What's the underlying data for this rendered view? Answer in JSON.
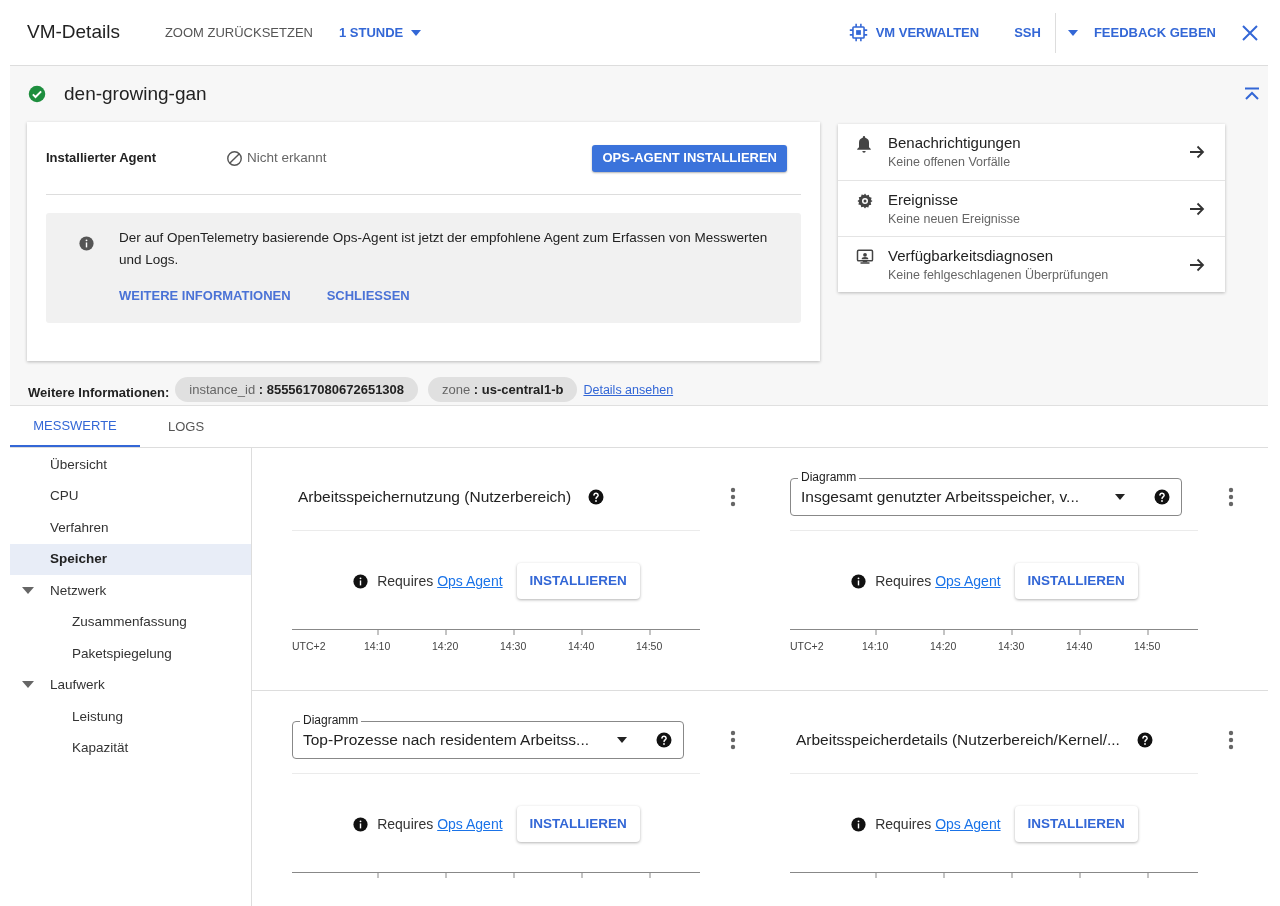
{
  "header": {
    "title": "VM-Details",
    "zoom_reset": "ZOOM ZURÜCKSETZEN",
    "time_range": "1 STUNDE",
    "manage": "VM VERWALTEN",
    "ssh": "SSH",
    "feedback": "FEEDBACK GEBEN"
  },
  "instance": {
    "name": "den-growing-gan",
    "running": true
  },
  "agent": {
    "label": "Installierter Agent",
    "status": "Nicht erkannt",
    "install_button": "OPS-AGENT INSTALLIEREN",
    "notice": "Der auf OpenTelemetry basierende Ops-Agent ist jetzt der empfohlene Agent zum Erfassen von Messwerten und Logs.",
    "actions": [
      "WEITERE INFORMATIONEN",
      "SCHLIESSEN"
    ]
  },
  "links": [
    {
      "kind": "bell",
      "title": "Benachrichtigungen",
      "subtitle": "Keine offenen Vorfälle"
    },
    {
      "kind": "gear",
      "title": "Ereignisse",
      "subtitle": "Keine neuen Ereignisse"
    },
    {
      "kind": "monitor",
      "title": "Verfügbarkeitsdiagnosen",
      "subtitle": "Keine fehlgeschlagenen Überprüfungen"
    }
  ],
  "more_info": {
    "label": "Weitere Informationen:",
    "chips": [
      "instance_id **: 8555617080672651308**",
      "zone **: us-central1-b**"
    ],
    "link": "Details ansehen"
  },
  "tabs": [
    {
      "label": "MESSWERTE",
      "selected": true
    },
    {
      "label": "LOGS",
      "selected": false
    }
  ],
  "sidebar": [
    {
      "label": "Übersicht",
      "selected": false
    },
    {
      "label": "CPU",
      "selected": false
    },
    {
      "label": "Verfahren",
      "selected": false
    },
    {
      "label": "Speicher",
      "selected": true
    },
    {
      "label": "Netzwerk",
      "selected": false,
      "expanded": true,
      "children": [
        {
          "label": "Zusammenfassung",
          "selected": false
        },
        {
          "label": "Paketspiegelung",
          "selected": false
        }
      ]
    },
    {
      "label": "Laufwerk",
      "selected": false,
      "expanded": true,
      "children": [
        {
          "label": "Leistung",
          "selected": false
        },
        {
          "label": "Kapazität",
          "selected": false
        }
      ]
    }
  ],
  "charts": [
    {
      "kind": "title",
      "title": "Arbeitsspeichernutzung (Nutzerbereich)",
      "requires": "Requires",
      "link": "Ops Agent",
      "button": "INSTALLIEREN",
      "axis_labels": [
        "UTC+2",
        "14:10",
        "14:20",
        "14:30",
        "14:40",
        "14:50"
      ]
    },
    {
      "kind": "select",
      "select_label": "Diagramm",
      "title": "Insgesamt genutzter Arbeitsspeicher, v...",
      "requires": "Requires",
      "link": "Ops Agent",
      "button": "INSTALLIEREN",
      "axis_labels": [
        "UTC+2",
        "14:10",
        "14:20",
        "14:30",
        "14:40",
        "14:50"
      ]
    },
    {
      "kind": "select",
      "select_label": "Diagramm",
      "title": "Top-Prozesse nach residentem Arbeitss...",
      "requires": "Requires",
      "link": "Ops Agent",
      "button": "INSTALLIEREN"
    },
    {
      "kind": "title",
      "title": "Arbeitsspeicherdetails (Nutzerbereich/Kernel/...",
      "requires": "Requires",
      "link": "Ops Agent",
      "button": "INSTALLIEREN"
    }
  ]
}
